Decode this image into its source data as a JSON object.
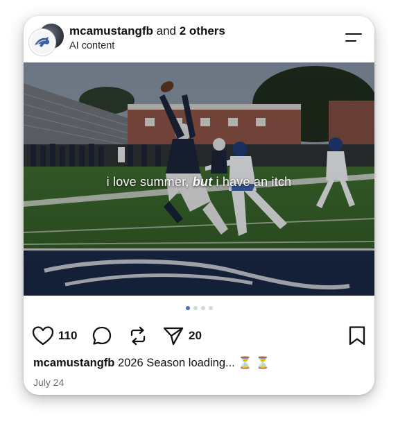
{
  "post": {
    "author": "mcamustangfb",
    "coauthors_text": " and ",
    "coauthors_bold": "2 others",
    "label": "AI content",
    "image_overlay": {
      "before": "i love summer, ",
      "emphasis": "but",
      "after": " i have an itch"
    },
    "carousel": {
      "count": 4,
      "active_index": 0
    },
    "likes": "110",
    "shares": "20",
    "caption_author": "mcamustangfb",
    "caption_text": " 2026 Season loading... ",
    "caption_emoji": "⏳ ⏳",
    "date": "July 24"
  },
  "icons": {
    "menu": "menu-lines-icon",
    "like": "heart-icon",
    "comment": "comment-bubble-icon",
    "repost": "repost-arrows-icon",
    "share": "send-paper-plane-icon",
    "save": "bookmark-icon"
  },
  "colors": {
    "active_dot": "#4f6db8",
    "inactive_dot": "#d3d6db",
    "text": "#111111",
    "muted": "#6b6f75"
  }
}
